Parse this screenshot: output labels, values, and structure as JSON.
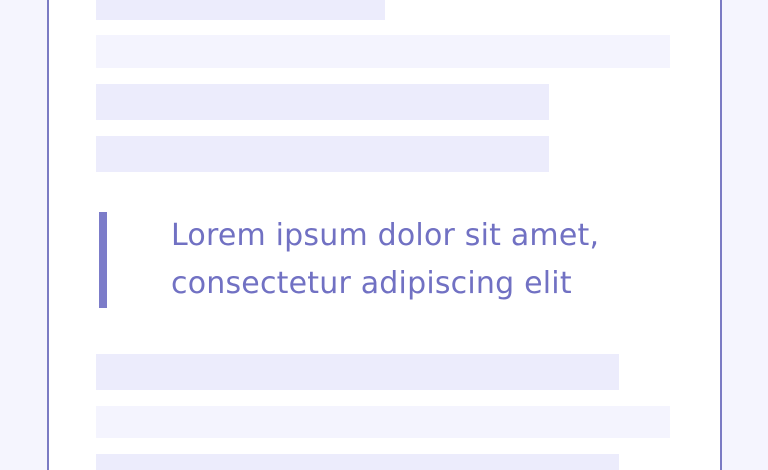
{
  "quote": {
    "text": "Lorem ipsum dolor sit amet, consectetur adipiscing elit"
  },
  "colors": {
    "background": "#f5f5fe",
    "page": "#ffffff",
    "border": "#7b7bc4",
    "placeholder_light": "#f4f4fe",
    "placeholder_mid": "#ececfc",
    "quote_accent": "#7c7cc9",
    "quote_text": "#7171c3"
  }
}
